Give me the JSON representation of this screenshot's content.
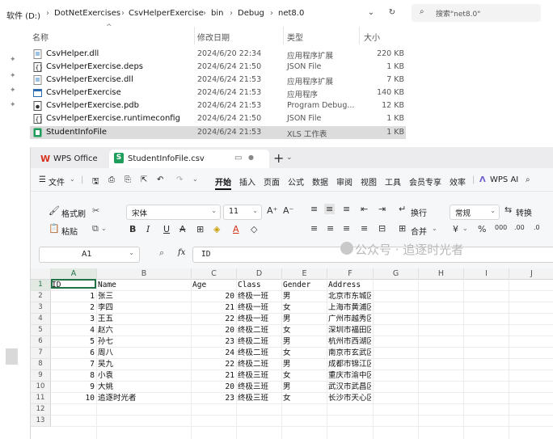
{
  "explorer": {
    "breadcrumbs": [
      "软件 (D:)",
      "DotNetExercises",
      "CsvHelperExercise",
      "bin",
      "Debug",
      "net8.0"
    ],
    "search_placeholder": "搜索\"net8.0\"",
    "columns": {
      "name": "名称",
      "date": "修改日期",
      "type": "类型",
      "size": "大小"
    },
    "files": [
      {
        "name": "CsvHelper.dll",
        "date": "2024/6/20 22:34",
        "type": "应用程序扩展",
        "size": "220 KB",
        "icon": "dll-file-icon"
      },
      {
        "name": "CsvHelperExercise.deps",
        "date": "2024/6/24 21:50",
        "type": "JSON File",
        "size": "1 KB",
        "icon": "json-file-icon"
      },
      {
        "name": "CsvHelperExercise.dll",
        "date": "2024/6/24 21:53",
        "type": "应用程序扩展",
        "size": "7 KB",
        "icon": "dll-file-icon"
      },
      {
        "name": "CsvHelperExercise",
        "date": "2024/6/24 21:53",
        "type": "应用程序",
        "size": "140 KB",
        "icon": "exe-file-icon"
      },
      {
        "name": "CsvHelperExercise.pdb",
        "date": "2024/6/24 21:53",
        "type": "Program Debug...",
        "size": "12 KB",
        "icon": "pdb-file-icon"
      },
      {
        "name": "CsvHelperExercise.runtimeconfig",
        "date": "2024/6/24 21:50",
        "type": "JSON File",
        "size": "1 KB",
        "icon": "json-file-icon"
      },
      {
        "name": "StudentInfoFile",
        "date": "2024/6/24 21:53",
        "type": "XLS 工作表",
        "size": "1 KB",
        "icon": "xls-file-icon",
        "selected": true
      }
    ]
  },
  "wps": {
    "tabs": [
      {
        "label": "WPS Office",
        "icon": "wps-logo-icon"
      },
      {
        "label": "StudentInfoFile.csv",
        "icon": "sheet-s-icon"
      }
    ],
    "menu": {
      "file": "文件",
      "items": [
        "开始",
        "插入",
        "页面",
        "公式",
        "数据",
        "审阅",
        "视图",
        "工具",
        "会员专享",
        "效率"
      ],
      "active": "开始",
      "wps_ai": "WPS AI"
    },
    "ribbon": {
      "format_painter": "格式刷",
      "paste": "粘贴",
      "font_name": "宋体",
      "font_size": "11",
      "wrap": "换行",
      "merge": "合并",
      "number_format": "常规",
      "convert": "转换",
      "bold": "B",
      "italic": "I",
      "underline": "U",
      "currency": "¥",
      "percent": "%"
    },
    "formula_bar": {
      "name_box": "A1",
      "fx": "fx",
      "content": "ID"
    },
    "sheet": {
      "columns": [
        "A",
        "B",
        "C",
        "D",
        "E",
        "F",
        "G",
        "H",
        "I",
        "J"
      ],
      "row_numbers": [
        "1",
        "2",
        "3",
        "4",
        "5",
        "6",
        "7",
        "8",
        "9",
        "10",
        "11",
        "12",
        "13"
      ],
      "header": [
        "ID",
        "Name",
        "Age",
        "Class",
        "Gender",
        "Address"
      ],
      "rows": [
        [
          "1",
          "张三",
          "20",
          "终极一班",
          "男",
          "北京市东城区"
        ],
        [
          "2",
          "李四",
          "21",
          "终极一班",
          "女",
          "上海市黄浦区"
        ],
        [
          "3",
          "王五",
          "22",
          "终极一班",
          "男",
          "广州市越秀区"
        ],
        [
          "4",
          "赵六",
          "20",
          "终极二班",
          "女",
          "深圳市福田区"
        ],
        [
          "5",
          "孙七",
          "23",
          "终极二班",
          "男",
          "杭州市西湖区"
        ],
        [
          "6",
          "周八",
          "24",
          "终极二班",
          "女",
          "南京市玄武区"
        ],
        [
          "7",
          "吴九",
          "22",
          "终极二班",
          "男",
          "成都市锦江区"
        ],
        [
          "8",
          "小袁",
          "21",
          "终极三班",
          "女",
          "重庆市渝中区"
        ],
        [
          "9",
          "大姚",
          "20",
          "终极三班",
          "男",
          "武汉市武昌区"
        ],
        [
          "10",
          "追逐时光者",
          "23",
          "终极三班",
          "女",
          "长沙市天心区"
        ]
      ]
    }
  },
  "watermark": "公众号 · 追逐时光者",
  "colors": {
    "accent_green": "#217346",
    "wps_red": "#d7311e",
    "selection": "#dcdcdc"
  }
}
